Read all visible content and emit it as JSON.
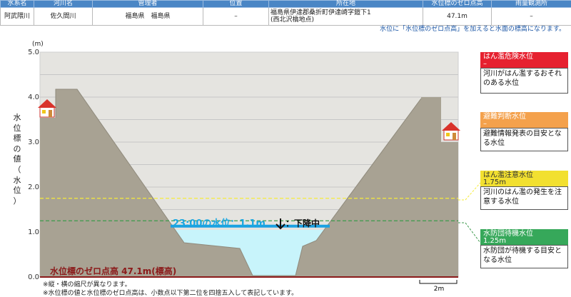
{
  "station": {
    "headers": [
      "水系名",
      "河川名",
      "管理者",
      "位置",
      "所在地",
      "水位標のゼロ点高",
      "雨量観測所"
    ],
    "values": [
      "阿武隈川",
      "佐久間川",
      "福島県　福島県",
      "–",
      "福島県伊達郡桑折町伊達崎字鎧下1",
      "47.1m",
      "–"
    ],
    "location_sub": "(西北沢橋地点)"
  },
  "note": "水位に「水位標のゼロ点高」を加えると水面の標高になります。",
  "chart": {
    "unit": "(m)",
    "yticks": [
      "5.0",
      "4.0",
      "3.0",
      "2.0",
      "1.0",
      "0.0"
    ],
    "ylabel_chars": [
      "水",
      "位",
      "標",
      "の",
      "値",
      "（",
      "水",
      "位",
      "）"
    ],
    "water_label": "23:00の水位：1.1m",
    "trend_label": "：下降中",
    "zero_label": "水位標のゼロ点高 47.1m(標高)",
    "scale_label": "2m"
  },
  "chart_data": {
    "type": "area",
    "ylim": [
      0,
      5
    ],
    "current_level": 1.1,
    "thresholds": [
      {
        "name": "はん濫注意水位",
        "value": 1.75,
        "color": "#f5ec3a"
      },
      {
        "name": "水防団待機水位",
        "value": 1.25,
        "color": "#3c9a4c"
      }
    ]
  },
  "levels": [
    {
      "title": "はん濫危険水位",
      "value": "–",
      "desc": "河川がはん濫するおそれのある水位",
      "color": "#e6212f"
    },
    {
      "title": "避難判断水位",
      "value": "–",
      "desc": "避難情報発表の目安となる水位",
      "color": "#f4a14c"
    },
    {
      "title": "はん濫注意水位",
      "value": "1.75m",
      "desc": "河川のはん濫の発生を注意する水位",
      "color": "#f2e030"
    },
    {
      "title": "水防団待機水位",
      "value": "1.25m",
      "desc": "水防団が待機する目安となる水位",
      "color": "#36a85a"
    }
  ],
  "footnotes": [
    "※縦・横の縮尺が異なります。",
    "※水位標の値と水位標のゼロ点高は、小数点以下第二位を四捨五入して表記しています。"
  ],
  "colors": {
    "header": "#4a86c5",
    "bank": "#a8a293",
    "water": "#c8f4fb",
    "water_line": "#1ba1e2",
    "zero_line": "#8b1a1a"
  }
}
